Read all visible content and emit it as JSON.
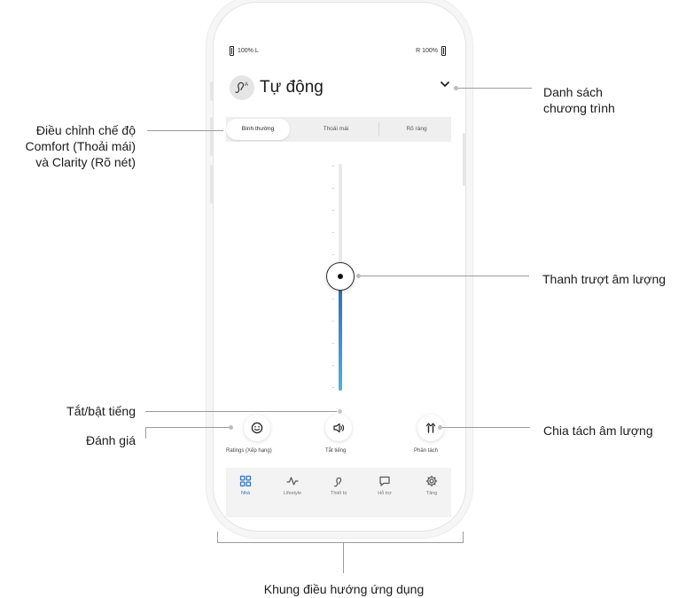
{
  "status": {
    "left_battery": "100% L",
    "right_battery": "R 100%"
  },
  "program": {
    "title": "Tự động",
    "icon": "hearing-aid-icon",
    "chevron": "chevron-down-icon"
  },
  "segments": {
    "items": [
      "Bình thường",
      "Thoải mái",
      "Rõ ràng"
    ],
    "selected": "Bình thường"
  },
  "volume": {
    "level": 0.44
  },
  "actions": {
    "ratings": {
      "label": "Ratings (Xếp hạng)",
      "icon": "smiley-icon"
    },
    "mute": {
      "label": "Tắt tiếng",
      "icon": "speaker-icon"
    },
    "split": {
      "label": "Phân tách",
      "icon": "split-volume-icon"
    }
  },
  "nav": {
    "active": "Nhà",
    "items": [
      {
        "label": "Nhà",
        "icon": "home-grid-icon"
      },
      {
        "label": "Lifestyle",
        "icon": "activity-icon"
      },
      {
        "label": "Thiết bị",
        "icon": "hearing-aid-icon"
      },
      {
        "label": "Hỗ trợ",
        "icon": "chat-bubble-icon"
      },
      {
        "label": "Tăng",
        "icon": "gear-icon"
      }
    ]
  },
  "annotations": {
    "program_list": {
      "line1": "Danh sách",
      "line2": "chương trình"
    },
    "comfort_clarity": {
      "line1": "Điều chỉnh chế độ",
      "line2": "Comfort (Thoải mái)",
      "line3": "và Clarity (Rõ nét)"
    },
    "volume_slider": "Thanh trượt âm lượng",
    "mute_toggle": "Tắt/bật tiếng",
    "rating": "Đánh giá",
    "split_volume": "Chia tách âm lượng",
    "navigation": "Khung điều hướng ứng dụng"
  },
  "colors": {
    "accent": "#2b74c2",
    "fill_top": "#2f6ec0",
    "fill_bottom": "#4fb0e4",
    "leader_line": "#9b9b9b"
  }
}
